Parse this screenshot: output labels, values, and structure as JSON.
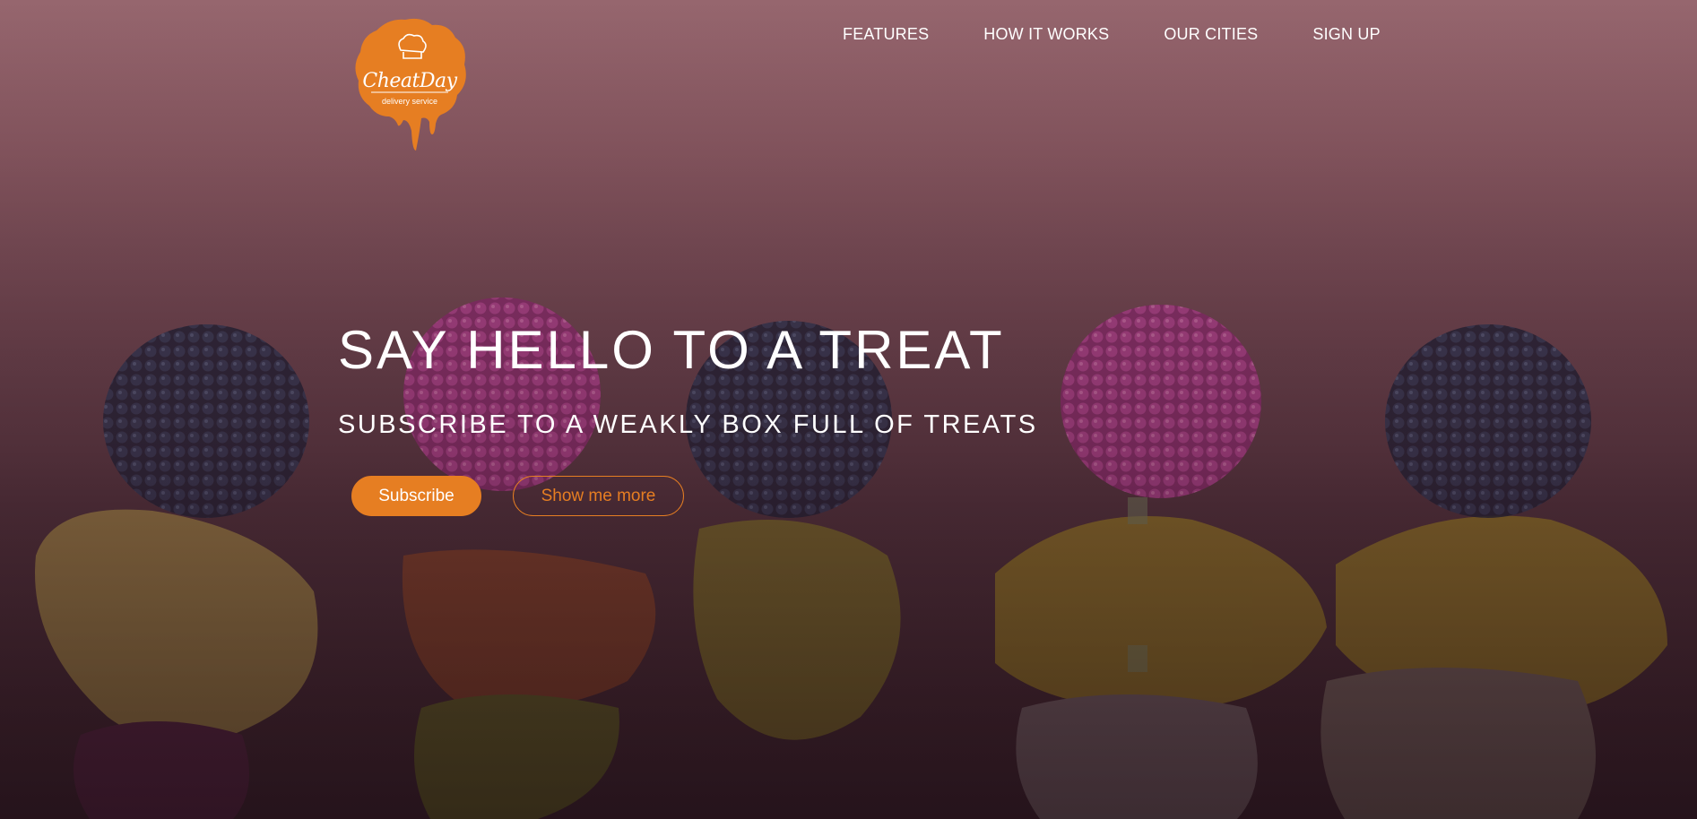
{
  "brand": {
    "name": "CheatDay",
    "tagline": "delivery service",
    "accent_color": "#e67e22"
  },
  "nav": {
    "items": [
      {
        "label": "FEATURES"
      },
      {
        "label": "HOW IT WORKS"
      },
      {
        "label": "OUR CITIES"
      },
      {
        "label": "SIGN UP"
      }
    ]
  },
  "hero": {
    "title": "SAY HELLO TO A TREAT",
    "subtitle": "SUBSCRIBE TO A WEAKLY BOX FULL OF TREATS",
    "primary_button": "Subscribe",
    "secondary_button": "Show me more",
    "background_image": "gummy-berry-candy-skewers"
  }
}
